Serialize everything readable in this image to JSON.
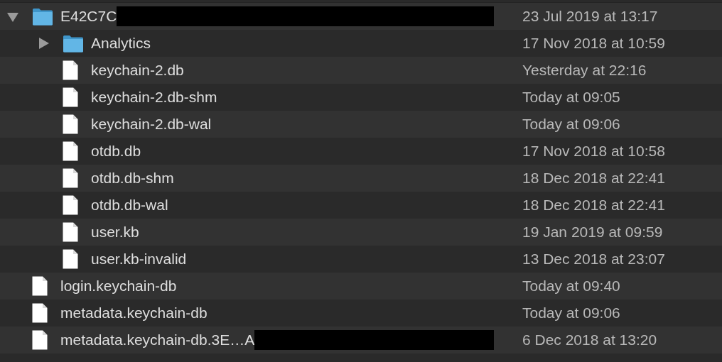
{
  "items": [
    {
      "name": "E42C7C",
      "kind": "folder",
      "expanded": true,
      "redacted": true,
      "date": "23 Jul 2019 at 13:17",
      "children": [
        {
          "name": "Analytics",
          "kind": "folder",
          "expanded": false,
          "date": "17 Nov 2018 at 10:59"
        },
        {
          "name": "keychain-2.db",
          "kind": "file",
          "date": "Yesterday at 22:16"
        },
        {
          "name": "keychain-2.db-shm",
          "kind": "file",
          "date": "Today at 09:05"
        },
        {
          "name": "keychain-2.db-wal",
          "kind": "file",
          "date": "Today at 09:06"
        },
        {
          "name": "otdb.db",
          "kind": "file",
          "date": "17 Nov 2018 at 10:58"
        },
        {
          "name": "otdb.db-shm",
          "kind": "file",
          "date": "18 Dec 2018 at 22:41"
        },
        {
          "name": "otdb.db-wal",
          "kind": "file",
          "date": "18 Dec 2018 at 22:41"
        },
        {
          "name": "user.kb",
          "kind": "file",
          "date": "19 Jan 2019 at 09:59"
        },
        {
          "name": "user.kb-invalid",
          "kind": "file",
          "date": "13 Dec 2018 at 23:07"
        }
      ]
    },
    {
      "name": "login.keychain-db",
      "kind": "file",
      "date": "Today at 09:40"
    },
    {
      "name": "metadata.keychain-db",
      "kind": "file",
      "date": "Today at 09:06"
    },
    {
      "name": "metadata.keychain-db.3E…A",
      "kind": "file",
      "redacted": true,
      "date": "6 Dec 2018 at 13:20"
    }
  ]
}
